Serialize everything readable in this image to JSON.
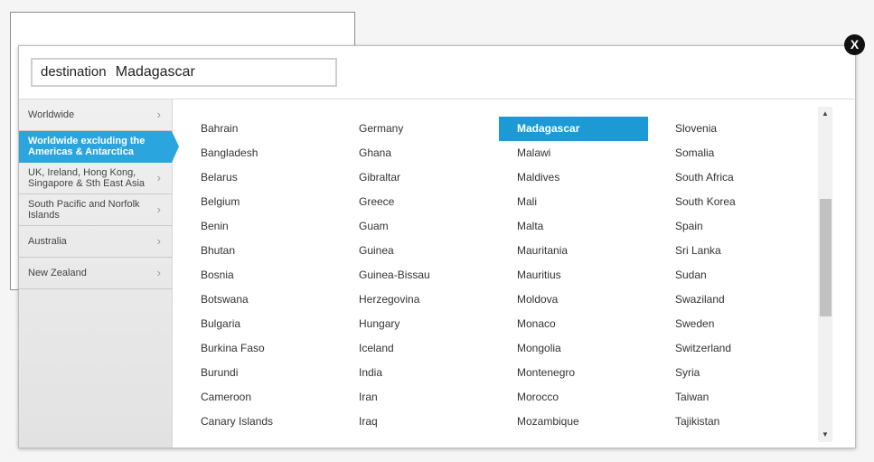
{
  "search": {
    "label": "destination",
    "value": "Madagascar"
  },
  "close_label": "X",
  "sidebar": {
    "items": [
      {
        "label": "Worldwide",
        "active": false
      },
      {
        "label": "Worldwide excluding the Americas & Antarctica",
        "active": true
      },
      {
        "label": "UK, Ireland, Hong Kong, Singapore & Sth East Asia",
        "active": false
      },
      {
        "label": "South Pacific and Norfolk Islands",
        "active": false
      },
      {
        "label": "Australia",
        "active": false
      },
      {
        "label": "New Zealand",
        "active": false
      }
    ]
  },
  "countries": {
    "selected": "Madagascar",
    "columns": [
      [
        "Bahrain",
        "Bangladesh",
        "Belarus",
        "Belgium",
        "Benin",
        "Bhutan",
        "Bosnia",
        "Botswana",
        "Bulgaria",
        "Burkina Faso",
        "Burundi",
        "Cameroon",
        "Canary Islands"
      ],
      [
        "Germany",
        "Ghana",
        "Gibraltar",
        "Greece",
        "Guam",
        "Guinea",
        "Guinea-Bissau",
        "Herzegovina",
        "Hungary",
        "Iceland",
        "India",
        "Iran",
        "Iraq"
      ],
      [
        "Madagascar",
        "Malawi",
        "Maldives",
        "Mali",
        "Malta",
        "Mauritania",
        "Mauritius",
        "Moldova",
        "Monaco",
        "Mongolia",
        "Montenegro",
        "Morocco",
        "Mozambique"
      ],
      [
        "Slovenia",
        "Somalia",
        "South Africa",
        "South Korea",
        "Spain",
        "Sri Lanka",
        "Sudan",
        "Swaziland",
        "Sweden",
        "Switzerland",
        "Syria",
        "Taiwan",
        "Tajikistan"
      ]
    ]
  },
  "colors": {
    "accent": "#2ba5dd",
    "selected": "#1d9ad3"
  }
}
